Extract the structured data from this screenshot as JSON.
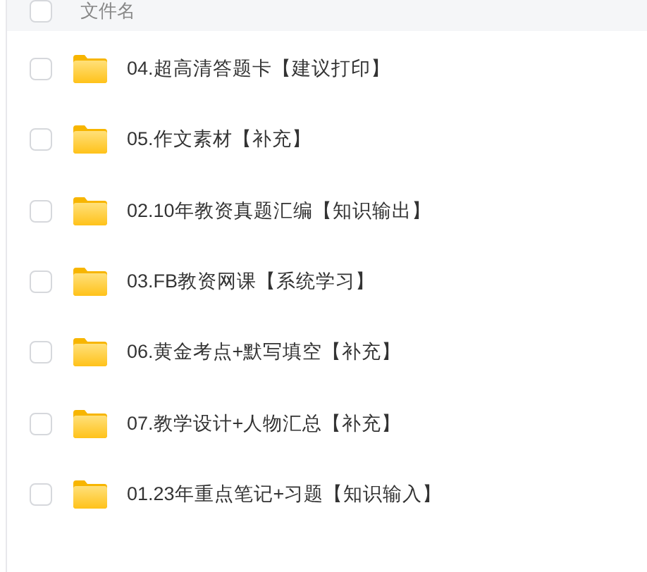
{
  "header": {
    "checked": false,
    "label": "文件名"
  },
  "files": [
    {
      "name": "04.超高清答题卡【建议打印】",
      "checked": false
    },
    {
      "name": "05.作文素材【补充】",
      "checked": false
    },
    {
      "name": "02.10年教资真题汇编【知识输出】",
      "checked": false
    },
    {
      "name": "03.FB教资网课【系统学习】",
      "checked": false
    },
    {
      "name": "06.黄金考点+默写填空【补充】",
      "checked": false
    },
    {
      "name": "07.教学设计+人物汇总【补充】",
      "checked": false
    },
    {
      "name": "01.23年重点笔记+习题【知识输入】",
      "checked": false
    }
  ]
}
